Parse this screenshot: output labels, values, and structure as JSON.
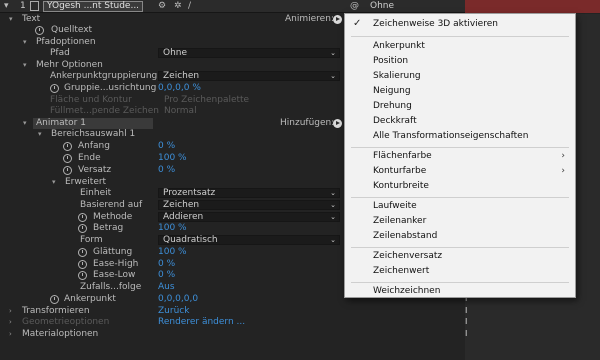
{
  "layer": {
    "number": "1",
    "name": "YOgesh ...nt Stude...",
    "parent": "Ohne"
  },
  "rows": {
    "text": "Text",
    "animate_label": "Animieren:",
    "quelltext": "Quelltext",
    "pfadoptionen": "Pfadoptionen",
    "pfad": "Pfad",
    "pfad_value": "Ohne",
    "mehr_optionen": "Mehr Optionen",
    "ankerpunktgruppierung": "Ankerpunktgruppierung",
    "ankerpunktgruppierung_value": "Zeichen",
    "gruppierung_ausrichtung": "Gruppie...usrichtung",
    "gruppierung_ausrichtung_value": "0,0,0,0 %",
    "flaeche_kontur": "Fläche und Kontur",
    "flaeche_kontur_value": "Pro Zeichenpalette",
    "fuellmethode": "Füllmet...pende Zeichen",
    "fuellmethode_value": "Normal",
    "animator": "Animator 1",
    "hinzufuegen": "Hinzufügen:",
    "bereichsauswahl": "Bereichsauswahl 1",
    "anfang": "Anfang",
    "anfang_value": "0 %",
    "ende": "Ende",
    "ende_value": "100 %",
    "versatz": "Versatz",
    "versatz_value": "0 %",
    "erweitert": "Erweitert",
    "einheit": "Einheit",
    "einheit_value": "Prozentsatz",
    "basierend": "Basierend auf",
    "basierend_value": "Zeichen",
    "methode": "Methode",
    "methode_value": "Addieren",
    "betrag": "Betrag",
    "betrag_value": "100 %",
    "form": "Form",
    "form_value": "Quadratisch",
    "glaettung": "Glättung",
    "glaettung_value": "100 %",
    "ease_high": "Ease-High",
    "ease_high_value": "0 %",
    "ease_low": "Ease-Low",
    "ease_low_value": "0 %",
    "zufallsfolge": "Zufalls...folge",
    "zufallsfolge_value": "Aus",
    "ankerpunkt": "Ankerpunkt",
    "ankerpunkt_value": "0,0,0,0,0",
    "transformieren": "Transformieren",
    "transformieren_value": "Zurück",
    "geometrieoptionen": "Geometrieoptionen",
    "geometrieoptionen_value": "Renderer ändern ...",
    "materialoptionen": "Materialoptionen"
  },
  "menu": {
    "items": [
      {
        "label": "Zeichenweise 3D aktivieren",
        "checked": true
      },
      {
        "label": "Ankerpunkt"
      },
      {
        "label": "Position"
      },
      {
        "label": "Skalierung"
      },
      {
        "label": "Neigung"
      },
      {
        "label": "Drehung"
      },
      {
        "label": "Deckkraft"
      },
      {
        "label": "Alle Transformationseigenschaften"
      },
      {
        "label": "Flächenfarbe",
        "submenu": true
      },
      {
        "label": "Konturfarbe",
        "submenu": true
      },
      {
        "label": "Konturbreite"
      },
      {
        "label": "Laufweite"
      },
      {
        "label": "Zeilenanker"
      },
      {
        "label": "Zeilenabstand"
      },
      {
        "label": "Zeichenversatz"
      },
      {
        "label": "Zeichenwert"
      },
      {
        "label": "Weichzeichnen"
      }
    ]
  },
  "icons": {
    "checkmark": "check-icon",
    "submenu": "chevron-right-icon",
    "stopwatch": "stopwatch-icon"
  },
  "colors": {
    "accent": "#3d8fd9",
    "menu_bg": "#f2f2f2",
    "panel_bg": "#232323"
  }
}
